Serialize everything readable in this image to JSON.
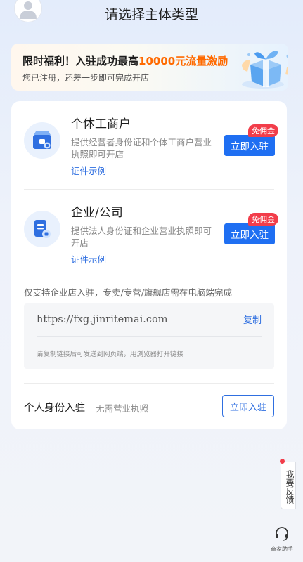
{
  "header": {
    "title": "请选择主体类型",
    "avatar_icon": "user-avatar-icon"
  },
  "promo": {
    "title_prefix": "限时福利！入驻成功最高",
    "title_highlight": "10000元流量激励",
    "subtitle": "您已注册，还差一步即可完成开店",
    "highlight_color": "#ff6a00"
  },
  "options": [
    {
      "icon": "shop-icon",
      "title": "个体工商户",
      "description": "提供经营者身份证和个体工商户营业执照即可开店",
      "example_link": "证件示例",
      "button_label": "立即入驻",
      "badge": "免佣金"
    },
    {
      "icon": "document-icon",
      "title": "企业/公司",
      "description": "提供法人身份证和企业营业执照即可开店",
      "example_link": "证件示例",
      "button_label": "立即入驻",
      "badge": "免佣金"
    }
  ],
  "enterprise_notice": "仅支持企业店入驻，专卖/专营/旗舰店需在电脑端完成",
  "url_box": {
    "url": "https://fxg.jinritemai.com",
    "copy_label": "复制",
    "hint": "请复制链接后可发送到网页端，用浏览器打开链接"
  },
  "personal": {
    "title": "个人身份入驻",
    "subtitle": "无需营业执照",
    "button_label": "立即入驻"
  },
  "sidebar": {
    "feedback_label": "我要反馈",
    "assistant_icon": "headset-icon",
    "assistant_label": "商家助手"
  },
  "colors": {
    "primary": "#1f6ff2",
    "link": "#2f6fe0",
    "badge": "#f23d4a"
  }
}
